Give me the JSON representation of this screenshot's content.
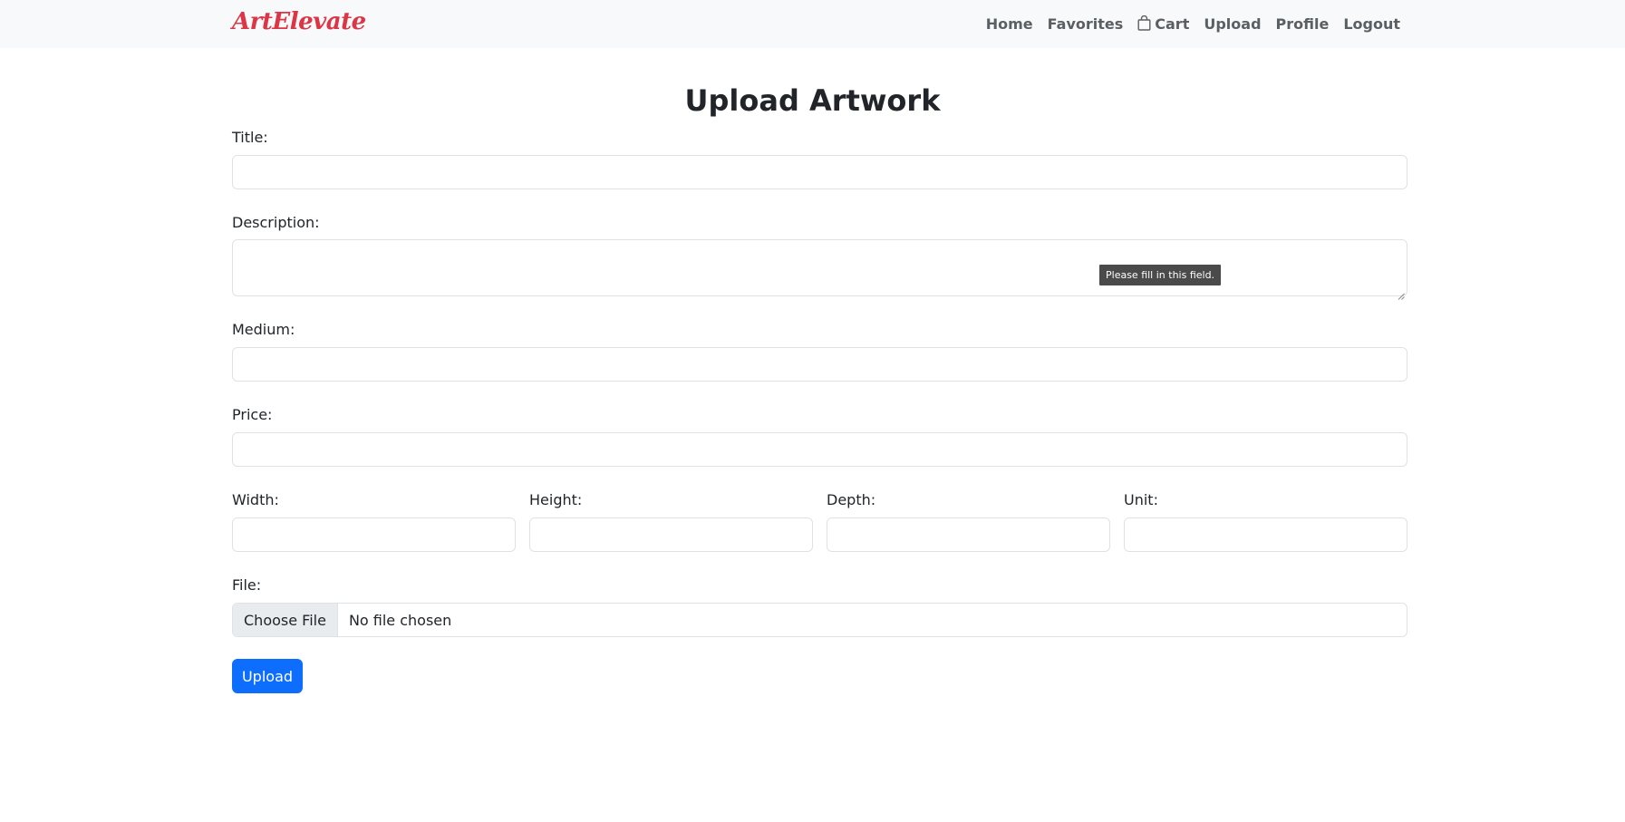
{
  "navbar": {
    "brand": "ArtElevate",
    "items": [
      {
        "label": "Home"
      },
      {
        "label": "Favorites"
      },
      {
        "label": "Cart",
        "icon": "bag-icon"
      },
      {
        "label": "Upload"
      },
      {
        "label": "Profile"
      },
      {
        "label": "Logout"
      }
    ]
  },
  "form": {
    "title": "Upload Artwork",
    "labels": {
      "title": "Title:",
      "description": "Description:",
      "medium": "Medium:",
      "price": "Price:",
      "width": "Width:",
      "height": "Height:",
      "depth": "Depth:",
      "unit": "Unit:",
      "file": "File:"
    },
    "values": {
      "title": "",
      "description": "",
      "medium": "",
      "price": "",
      "width": "",
      "height": "",
      "depth": "",
      "unit": ""
    },
    "file_button": "Choose File",
    "file_status": "No file chosen",
    "submit": "Upload",
    "validation_tooltip": "Please fill in this field."
  },
  "colors": {
    "brand": "#dc3545",
    "primary": "#0d6efd",
    "navbar_bg": "#f8f9fa"
  }
}
